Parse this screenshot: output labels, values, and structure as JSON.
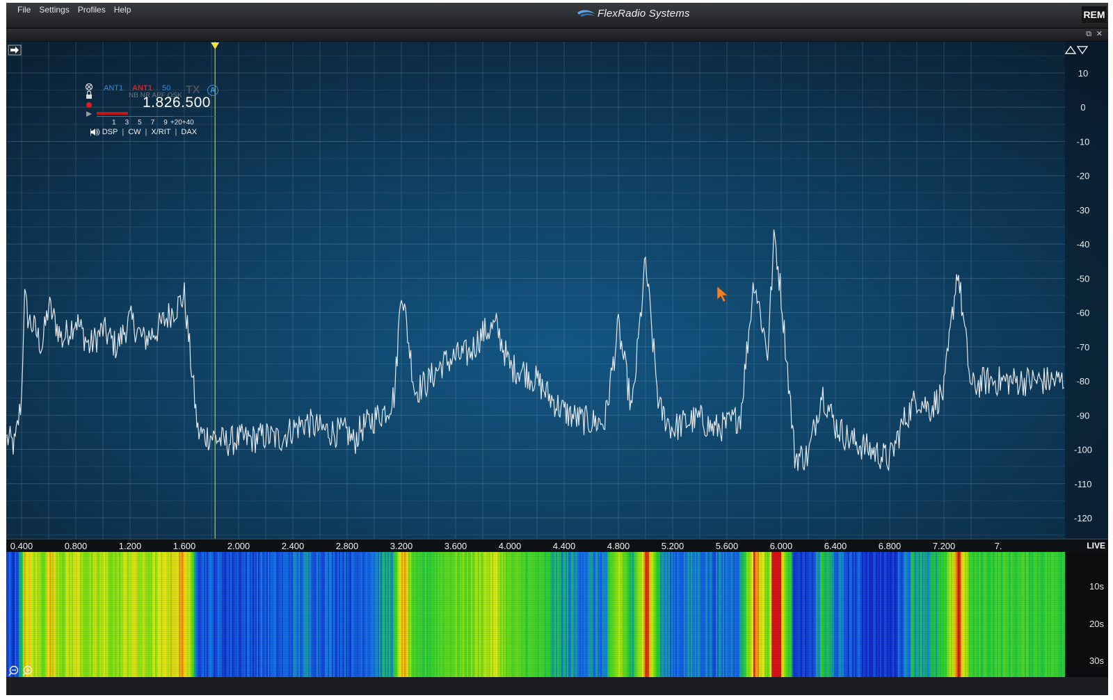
{
  "menu": {
    "file": "File",
    "settings": "Settings",
    "profiles": "Profiles",
    "help": "Help"
  },
  "brand": "FlexRadio Systems",
  "rem_badge": "REM",
  "strip": {
    "restore": "⧉",
    "close": "✕",
    "collapse": "➡"
  },
  "slice": {
    "rx_antenna": "ANT1",
    "tx_antenna": "ANT1",
    "filter": "50",
    "tx_label": "TX",
    "letter": "A",
    "dsp_flags": "NB NR APF QSK",
    "frequency": "1.826.500",
    "smeter_scale": [
      "1",
      "3",
      "5",
      "7",
      "9",
      "+20",
      "+40"
    ],
    "tabs": {
      "dsp": "DSP",
      "cw": "CW",
      "xrit": "X/RIT",
      "dax": "DAX"
    },
    "accent_rx": "#2f8fe0",
    "accent_tx": "#e02020"
  },
  "db_labels": [
    "10",
    "0",
    "-10",
    "-20",
    "-30",
    "-40",
    "-50",
    "-60",
    "-70",
    "-80",
    "-90",
    "-100",
    "-110",
    "-120"
  ],
  "freq_labels": [
    "0.400",
    "0.800",
    "1.200",
    "1.600",
    "2.000",
    "2.400",
    "2.800",
    "3.200",
    "3.600",
    "4.000",
    "4.400",
    "4.800",
    "5.200",
    "5.600",
    "6.000",
    "6.400",
    "6.800",
    "7.200",
    "7."
  ],
  "live_label": "LIVE",
  "time_labels": [
    "10s",
    "20s",
    "30s"
  ],
  "zoom": {
    "out": "zoom out",
    "in": "zoom in"
  },
  "colors": {
    "trace": "#e4e8ec",
    "marker": "#e6e630",
    "background": "#123a58"
  },
  "chart_data": {
    "type": "line",
    "xlabel": "",
    "ylabel": "",
    "xlim": [
      0.3,
      7.5
    ],
    "ylim": [
      -125,
      15
    ],
    "tuned_frequency_mhz": 1.8265,
    "x": [
      0.3,
      0.35,
      0.4,
      0.42,
      0.45,
      0.5,
      0.55,
      0.6,
      0.7,
      0.8,
      0.9,
      1.0,
      1.1,
      1.2,
      1.3,
      1.4,
      1.5,
      1.55,
      1.6,
      1.65,
      1.7,
      1.75,
      1.8,
      1.9,
      2.0,
      2.1,
      2.2,
      2.3,
      2.4,
      2.5,
      2.6,
      2.7,
      2.8,
      2.85,
      2.9,
      3.0,
      3.1,
      3.15,
      3.2,
      3.3,
      3.4,
      3.5,
      3.6,
      3.7,
      3.8,
      3.9,
      4.0,
      4.1,
      4.2,
      4.3,
      4.4,
      4.5,
      4.6,
      4.7,
      4.8,
      4.9,
      5.0,
      5.05,
      5.1,
      5.2,
      5.3,
      5.4,
      5.5,
      5.6,
      5.7,
      5.8,
      5.9,
      5.95,
      6.0,
      6.05,
      6.1,
      6.2,
      6.3,
      6.4,
      6.5,
      6.6,
      6.7,
      6.8,
      6.9,
      7.0,
      7.1,
      7.2,
      7.3,
      7.4,
      7.5
    ],
    "values": [
      -97,
      -99,
      -85,
      -55,
      -62,
      -65,
      -70,
      -58,
      -68,
      -62,
      -70,
      -65,
      -70,
      -62,
      -68,
      -65,
      -60,
      -58,
      -55,
      -75,
      -95,
      -96,
      -96,
      -98,
      -97,
      -97,
      -96,
      -97,
      -94,
      -92,
      -94,
      -95,
      -95,
      -98,
      -94,
      -91,
      -88,
      -84,
      -52,
      -83,
      -80,
      -75,
      -73,
      -72,
      -66,
      -64,
      -76,
      -77,
      -80,
      -85,
      -89,
      -91,
      -92,
      -92,
      -64,
      -89,
      -45,
      -67,
      -88,
      -94,
      -92,
      -91,
      -94,
      -93,
      -90,
      -50,
      -72,
      -37,
      -55,
      -78,
      -102,
      -102,
      -83,
      -93,
      -97,
      -99,
      -101,
      -103,
      -92,
      -85,
      -88,
      -83,
      -47,
      -82,
      -80
    ]
  }
}
